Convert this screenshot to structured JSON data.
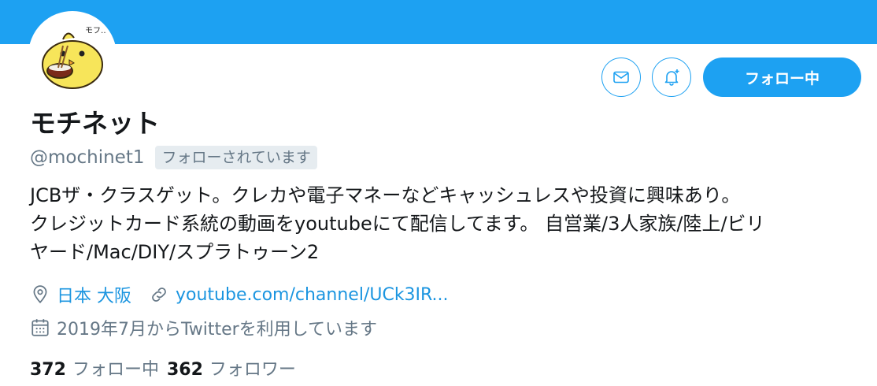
{
  "colors": {
    "accent": "#1da1f2",
    "link": "#1b95e0",
    "muted": "#657786",
    "text": "#14171a"
  },
  "profile": {
    "name": "モチネット",
    "handle": "@mochinet1",
    "follows_you_label": "フォローされています",
    "bio_line1": "JCBザ・クラスゲット。クレカや電子マネーなどキャッシュレスや投資に興味あり。",
    "bio_line2": "クレジットカード系統の動画をyoutubeにて配信してます。 自営業/3人家族/陸上/ビリ",
    "bio_line3": "ヤード/Mac/DIY/スプラトゥーン2",
    "location": "日本 大阪",
    "website": "youtube.com/channel/UCk3IR...",
    "joined": "2019年7月からTwitterを利用しています",
    "avatar_icon": "chick-mascot-avatar"
  },
  "actions": {
    "message_icon": "mail-icon",
    "notify_icon": "bell-plus-icon",
    "follow_label": "フォロー中"
  },
  "stats": {
    "following_count": "372",
    "following_label": "フォロー中",
    "followers_count": "362",
    "followers_label": "フォロワー"
  }
}
